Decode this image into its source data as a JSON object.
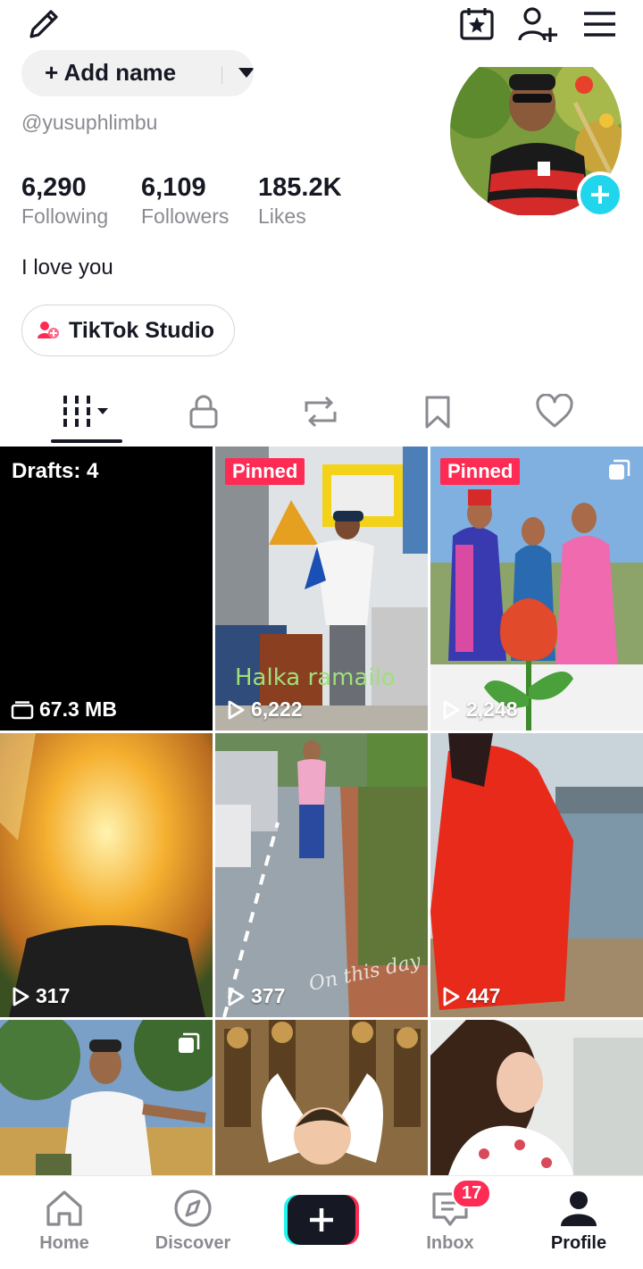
{
  "top_icons": [
    "edit-icon",
    "calendar-star-icon",
    "add-friend-icon",
    "menu-icon"
  ],
  "profile": {
    "add_name_label": "+ Add name",
    "username": "@yusuphlimbu",
    "bio": "I love you",
    "stats": [
      {
        "value": "6,290",
        "label": "Following"
      },
      {
        "value": "6,109",
        "label": "Followers"
      },
      {
        "value": "185.2K",
        "label": "Likes"
      }
    ],
    "studio_label": "TikTok Studio"
  },
  "tabs": [
    "videos-grid-icon",
    "private-lock-icon",
    "reposts-icon",
    "favorites-bookmark-icon",
    "liked-heart-icon"
  ],
  "videos": [
    {
      "type": "drafts",
      "drafts_label": "Drafts: 4",
      "size": "67.3 MB"
    },
    {
      "type": "video",
      "pinned": "Pinned",
      "views": "6,222",
      "overlay": "Halka ramailo"
    },
    {
      "type": "video",
      "pinned": "Pinned",
      "views": "2,248",
      "multi": true
    },
    {
      "type": "video",
      "views": "317"
    },
    {
      "type": "video",
      "views": "377",
      "overlay": "On this day"
    },
    {
      "type": "video",
      "views": "447"
    },
    {
      "type": "video",
      "multi": true
    },
    {
      "type": "video"
    },
    {
      "type": "video"
    }
  ],
  "nav": {
    "home": "Home",
    "discover": "Discover",
    "inbox": "Inbox",
    "inbox_badge": "17",
    "profile": "Profile"
  },
  "colors": {
    "accent": "#fe2c55",
    "cyan": "#25f4ee",
    "follow_plus": "#20d5ec"
  }
}
